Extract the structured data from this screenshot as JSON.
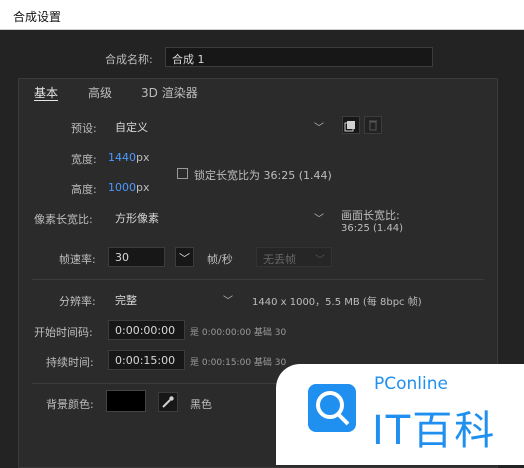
{
  "window": {
    "title": "合成设置"
  },
  "comp_name": {
    "label": "合成名称:",
    "value": "合成 1"
  },
  "tabs": [
    {
      "label": "基本",
      "active": true
    },
    {
      "label": "高级",
      "active": false
    },
    {
      "label": "3D 渲染器",
      "active": false
    }
  ],
  "preset": {
    "label": "预设:",
    "value": "自定义"
  },
  "width": {
    "label": "宽度:",
    "value": "1440",
    "unit": "px"
  },
  "height": {
    "label": "高度:",
    "value": "1000",
    "unit": "px"
  },
  "lock_ratio": {
    "label": "锁定长宽比为 36:25 (1.44)",
    "checked": false
  },
  "pixel_ratio": {
    "label": "像素长宽比:",
    "value": "方形像素"
  },
  "frame_ratio": {
    "label": "画面长宽比:",
    "value": "36:25 (1.44)"
  },
  "frame_rate": {
    "label": "帧速率:",
    "value": "30",
    "unit": "帧/秒",
    "drop_frame": "无丢帧"
  },
  "resolution": {
    "label": "分辨率:",
    "value": "完整",
    "info": "1440 x 1000，5.5 MB (每 8bpc 帧)"
  },
  "start_timecode": {
    "label": "开始时间码:",
    "value": "0:00:00:00",
    "info": "是 0:00:00:00  基础 30"
  },
  "duration": {
    "label": "持续时间:",
    "value": "0:00:15:00",
    "info": "是 0:00:15:00  基础 30"
  },
  "background": {
    "label": "背景颜色:",
    "color_name": "黑色",
    "color": "#000000"
  },
  "watermark": {
    "small": "PConline",
    "big": "IT百科"
  },
  "colors": {
    "accent": "#4a9bff",
    "watermark": "#1f8ff0"
  }
}
